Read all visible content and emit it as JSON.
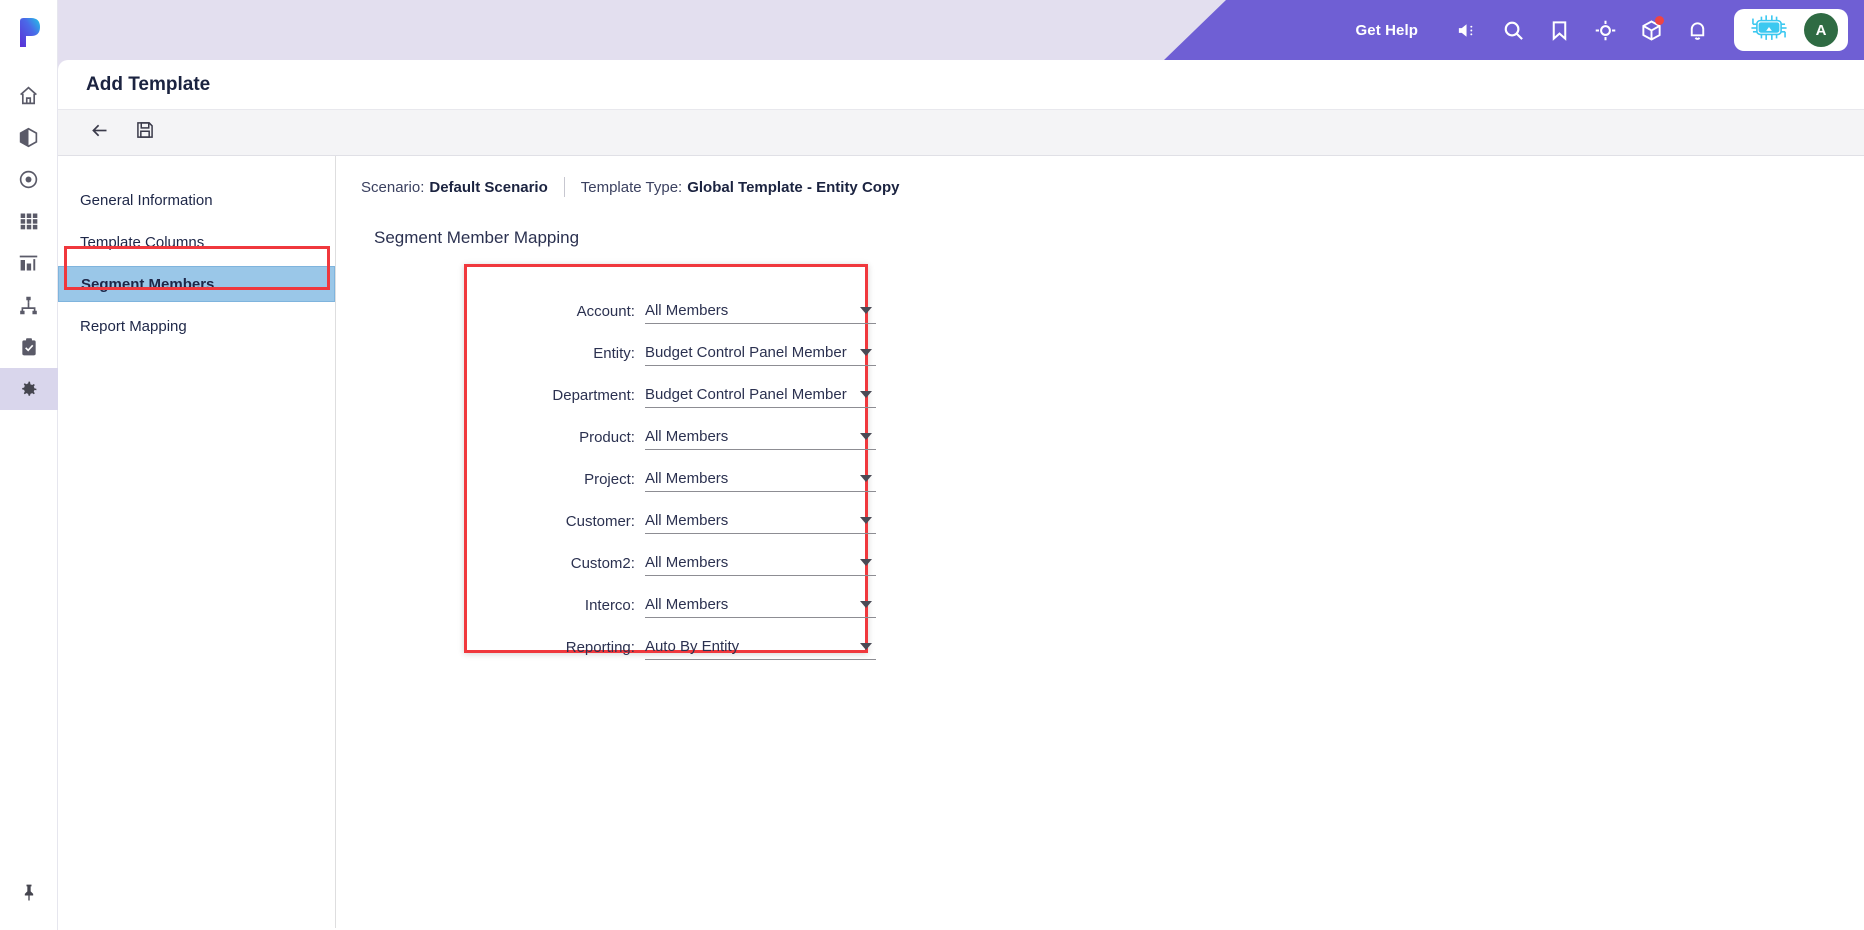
{
  "rail": {
    "logo_icon": "planful-logo-icon",
    "items": [
      {
        "name": "home",
        "icon": "home-icon"
      },
      {
        "name": "models",
        "icon": "cube-icon"
      },
      {
        "name": "target",
        "icon": "target-circle-icon"
      },
      {
        "name": "grid",
        "icon": "grid-icon"
      },
      {
        "name": "reports",
        "icon": "bar-chart-icon"
      },
      {
        "name": "hierarchy",
        "icon": "hierarchy-icon"
      },
      {
        "name": "tasks",
        "icon": "clipboard-check-icon"
      },
      {
        "name": "settings",
        "icon": "gear-icon"
      }
    ],
    "active_index": 7,
    "pin_icon": "pin-icon"
  },
  "topbar": {
    "get_help": "Get Help",
    "icons": [
      {
        "name": "announcement-icon",
        "badge": false
      },
      {
        "name": "search-icon",
        "badge": false
      },
      {
        "name": "bookmark-icon",
        "badge": false
      },
      {
        "name": "crosshair-icon",
        "badge": false
      },
      {
        "name": "package-icon",
        "badge": true
      },
      {
        "name": "bell-icon",
        "badge": false
      }
    ],
    "ai_icon": "ai-chip-icon",
    "avatar_initial": "A",
    "avatar_color": "#2f6b43",
    "accent_color": "#6f5fd4"
  },
  "page": {
    "title": "Add Template",
    "toolbar": [
      {
        "name": "back-button",
        "icon": "arrow-left-icon"
      },
      {
        "name": "save-button",
        "icon": "floppy-disk-icon"
      }
    ]
  },
  "nav": {
    "items": [
      {
        "label": "General Information",
        "selected": false
      },
      {
        "label": "Template Columns",
        "selected": false
      },
      {
        "label": "Segment Members",
        "selected": true
      },
      {
        "label": "Report Mapping",
        "selected": false
      }
    ],
    "highlight_color": "#f0383d",
    "selected_bg": "#9ac7e8"
  },
  "meta": {
    "scenario_label": "Scenario:",
    "scenario_value": "Default Scenario",
    "template_type_label": "Template Type:",
    "template_type_value": "Global Template - Entity Copy"
  },
  "section": {
    "title": "Segment Member Mapping",
    "highlight_color": "#f0383d"
  },
  "form": {
    "fields": [
      {
        "label": "Account:",
        "value": "All Members"
      },
      {
        "label": "Entity:",
        "value": "Budget Control Panel Member"
      },
      {
        "label": "Department:",
        "value": "Budget Control Panel Member"
      },
      {
        "label": "Product:",
        "value": "All Members"
      },
      {
        "label": "Project:",
        "value": "All Members"
      },
      {
        "label": "Customer:",
        "value": "All Members"
      },
      {
        "label": "Custom2:",
        "value": "All Members"
      },
      {
        "label": "Interco:",
        "value": "All Members"
      },
      {
        "label": "Reporting:",
        "value": "Auto By Entity"
      }
    ]
  }
}
